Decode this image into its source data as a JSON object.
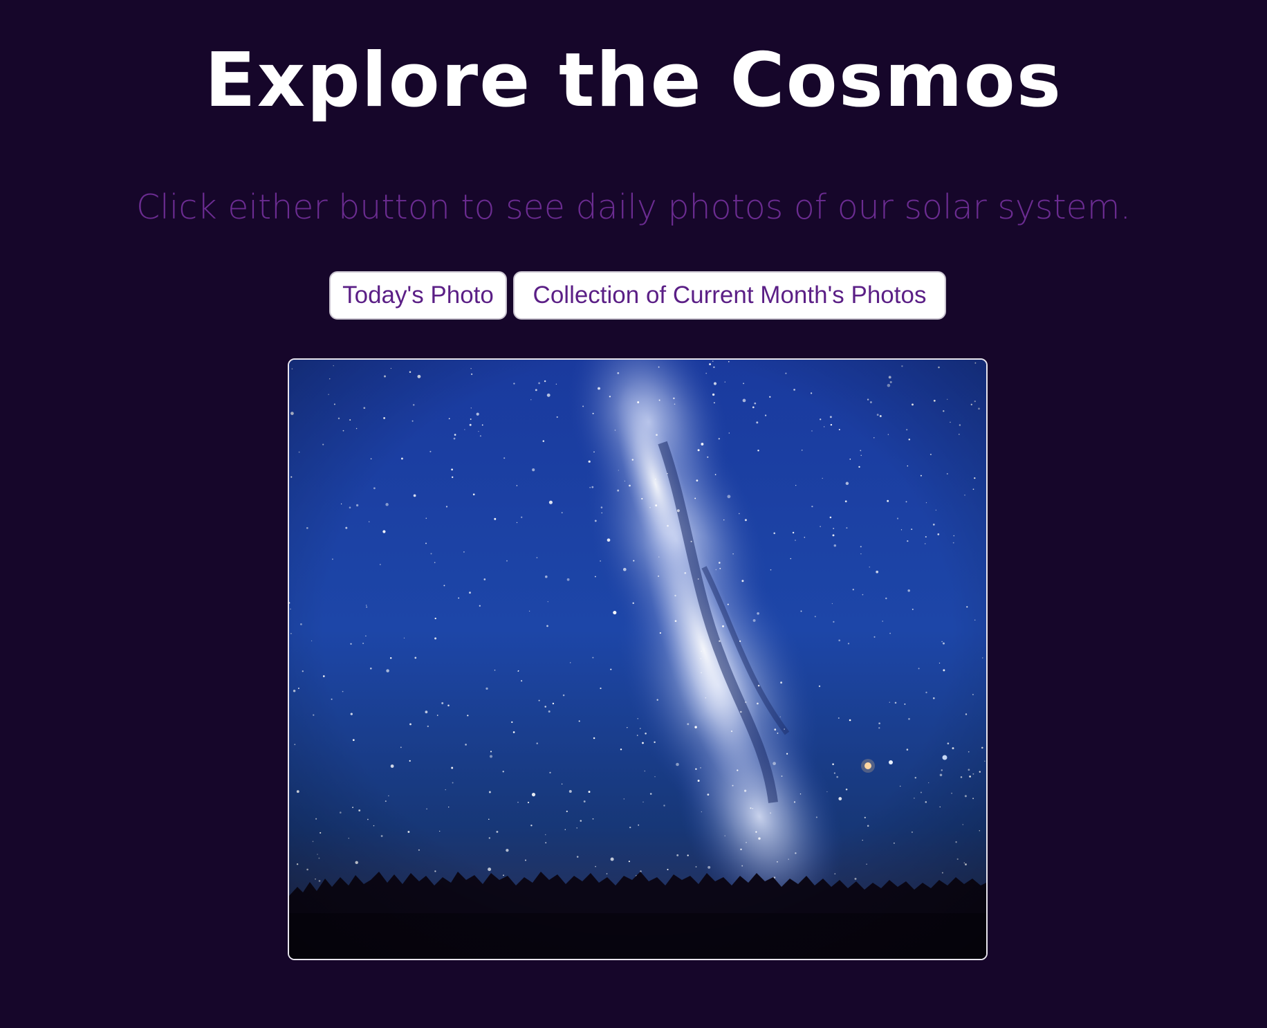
{
  "header": {
    "title": "Explore the Cosmos",
    "subtitle": "Click either button to see daily photos of our solar system."
  },
  "buttons": {
    "today_label": "Today's Photo",
    "month_label": "Collection of Current Month's Photos"
  },
  "photo": {
    "alt": "Milky Way over treeline at night"
  },
  "colors": {
    "background": "#16062a",
    "title": "#ffffff",
    "subtitle": "#6b2c91",
    "button_text": "#5b1f86",
    "button_bg": "#ffffff"
  }
}
